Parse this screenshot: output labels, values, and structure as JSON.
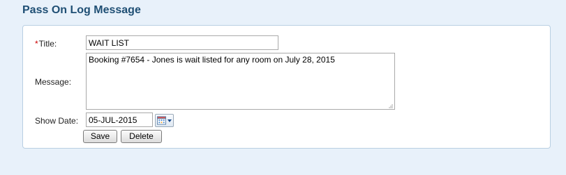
{
  "page": {
    "title": "Pass On Log Message"
  },
  "form": {
    "required_marker": "*",
    "title_label": "Title:",
    "title_value": "WAIT LIST",
    "message_label": "Message:",
    "message_value": "Booking #7654 - Jones is wait listed for any room on July 28, 2015",
    "show_date_label": "Show Date:",
    "show_date_value": "05-JUL-2015",
    "save_label": "Save",
    "delete_label": "Delete"
  },
  "icons": {
    "calendar": "calendar-icon",
    "dropdown": "chevron-down-icon",
    "resize": "resize-grip-icon"
  },
  "colors": {
    "page_background": "#e8f1fa",
    "title_color": "#1f4f74",
    "panel_border": "#b9cfe2",
    "required_color": "#cc0000"
  }
}
